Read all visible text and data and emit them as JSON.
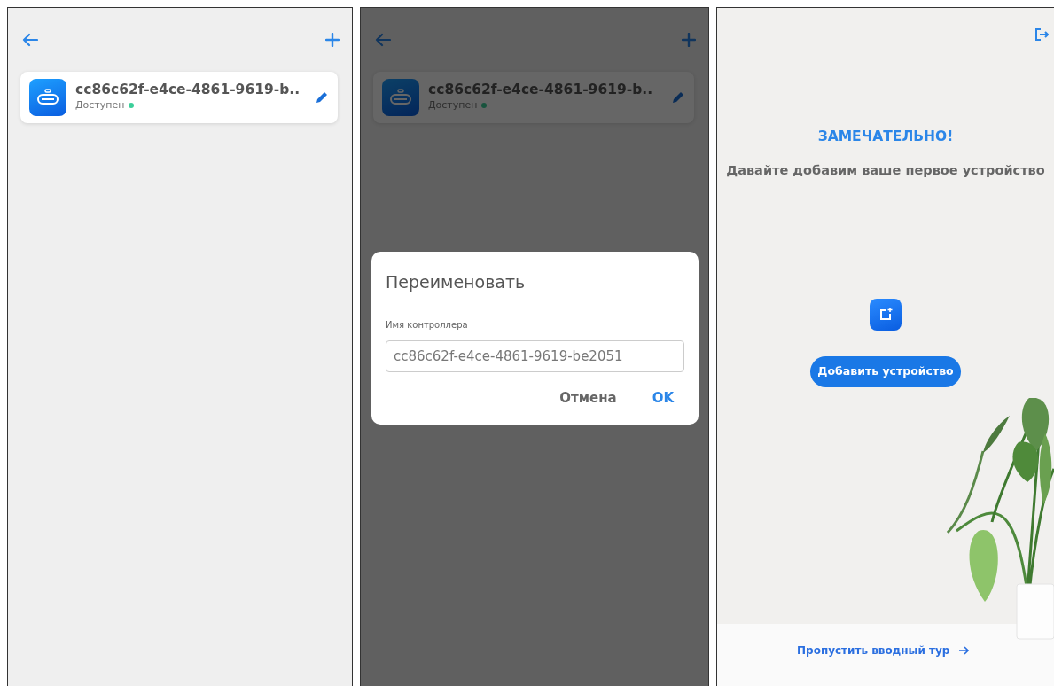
{
  "screens": [
    {
      "kind": "device_list",
      "devices": [
        {
          "name": "cc86c62f-e4ce-4861-9619-b..",
          "status": "Доступен",
          "online": true
        }
      ]
    },
    {
      "kind": "rename_dialog",
      "devices": [
        {
          "name": "cc86c62f-e4ce-4861-9619-b..",
          "status": "Доступен",
          "online": true
        }
      ],
      "dialog": {
        "title": "Переименовать",
        "field_label": "Имя контроллера",
        "value": "cc86c62f-e4ce-4861-9619-be2051",
        "cancel": "Отмена",
        "ok": "OK"
      }
    },
    {
      "kind": "onboarding",
      "title": "ЗАМЕЧАТЕЛЬНО!",
      "subtitle": "Давайте добавим ваше первое устройство",
      "add_button": "Добавить устройство",
      "skip_link": "Пропустить вводный тур"
    }
  ]
}
